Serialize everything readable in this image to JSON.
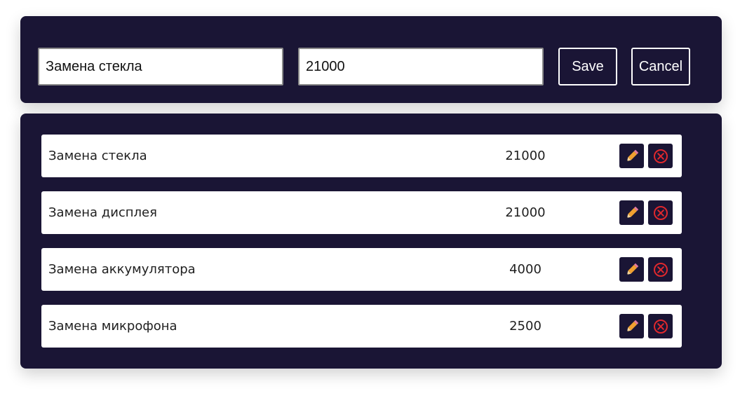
{
  "form": {
    "name_value": "Замена стекла",
    "price_value": "21000",
    "save_label": "Save",
    "cancel_label": "Cancel"
  },
  "services": [
    {
      "name": "Замена стекла",
      "price": "21000"
    },
    {
      "name": "Замена дисплея",
      "price": "21000"
    },
    {
      "name": "Замена аккумулятора",
      "price": "4000"
    },
    {
      "name": "Замена микрофона",
      "price": "2500"
    }
  ],
  "icons": {
    "edit": "pencil-icon",
    "delete": "close-circle-icon"
  },
  "colors": {
    "panel_bg": "#1a1535",
    "pencil": "#f0a030",
    "delete": "#e0282d"
  }
}
